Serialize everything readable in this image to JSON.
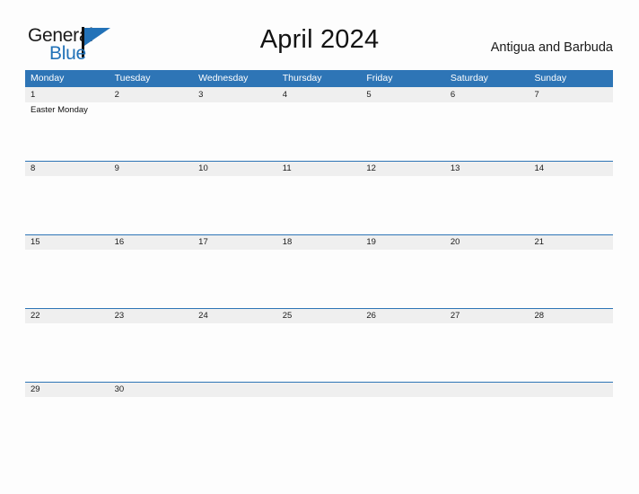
{
  "brand": {
    "name_part1": "General",
    "name_part2": "Blue",
    "flag_icon": "flag-icon",
    "primary_color": "#2272b8"
  },
  "header": {
    "title": "April 2024",
    "subtitle": "Antigua and Barbuda"
  },
  "calendar": {
    "header_color": "#2e75b6",
    "date_band_color": "#efefef",
    "weekdays": [
      "Monday",
      "Tuesday",
      "Wednesday",
      "Thursday",
      "Friday",
      "Saturday",
      "Sunday"
    ],
    "weeks": [
      {
        "days": [
          {
            "number": "1",
            "events": [
              "Easter Monday"
            ]
          },
          {
            "number": "2",
            "events": []
          },
          {
            "number": "3",
            "events": []
          },
          {
            "number": "4",
            "events": []
          },
          {
            "number": "5",
            "events": []
          },
          {
            "number": "6",
            "events": []
          },
          {
            "number": "7",
            "events": []
          }
        ]
      },
      {
        "days": [
          {
            "number": "8",
            "events": []
          },
          {
            "number": "9",
            "events": []
          },
          {
            "number": "10",
            "events": []
          },
          {
            "number": "11",
            "events": []
          },
          {
            "number": "12",
            "events": []
          },
          {
            "number": "13",
            "events": []
          },
          {
            "number": "14",
            "events": []
          }
        ]
      },
      {
        "days": [
          {
            "number": "15",
            "events": []
          },
          {
            "number": "16",
            "events": []
          },
          {
            "number": "17",
            "events": []
          },
          {
            "number": "18",
            "events": []
          },
          {
            "number": "19",
            "events": []
          },
          {
            "number": "20",
            "events": []
          },
          {
            "number": "21",
            "events": []
          }
        ]
      },
      {
        "days": [
          {
            "number": "22",
            "events": []
          },
          {
            "number": "23",
            "events": []
          },
          {
            "number": "24",
            "events": []
          },
          {
            "number": "25",
            "events": []
          },
          {
            "number": "26",
            "events": []
          },
          {
            "number": "27",
            "events": []
          },
          {
            "number": "28",
            "events": []
          }
        ]
      },
      {
        "days": [
          {
            "number": "29",
            "events": []
          },
          {
            "number": "30",
            "events": []
          },
          {
            "number": "",
            "events": []
          },
          {
            "number": "",
            "events": []
          },
          {
            "number": "",
            "events": []
          },
          {
            "number": "",
            "events": []
          },
          {
            "number": "",
            "events": []
          }
        ]
      }
    ]
  }
}
